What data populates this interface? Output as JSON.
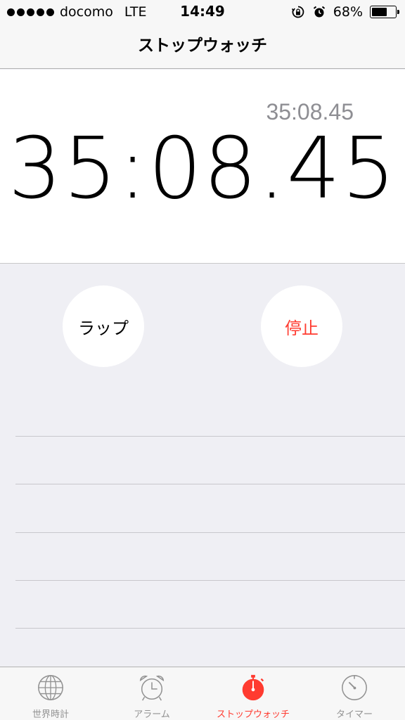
{
  "status_bar": {
    "carrier": "docomo",
    "network": "LTE",
    "time": "14:49",
    "battery": "68%",
    "battery_level": 0.68
  },
  "nav": {
    "title": "ストップウォッチ"
  },
  "stopwatch": {
    "lap_time": "35:08.45",
    "total_time": "35:08.45"
  },
  "buttons": {
    "lap_label": "ラップ",
    "stop_label": "停止"
  },
  "tabs": [
    {
      "label": "世界時計",
      "icon": "globe-icon",
      "active": false
    },
    {
      "label": "アラーム",
      "icon": "alarm-clock-icon",
      "active": false
    },
    {
      "label": "ストップウォッチ",
      "icon": "stopwatch-icon",
      "active": true
    },
    {
      "label": "タイマー",
      "icon": "timer-icon",
      "active": false
    }
  ],
  "colors": {
    "accent": "#ff3b30",
    "inactive": "#929292"
  }
}
